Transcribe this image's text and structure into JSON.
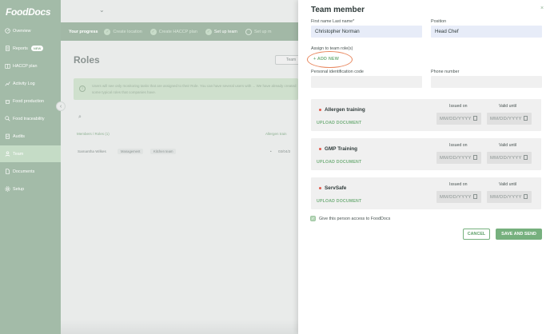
{
  "app": {
    "logo": "FoodDocs"
  },
  "sidebar": {
    "items": [
      {
        "label": "Overview",
        "icon": "gauge-icon"
      },
      {
        "label": "Reports",
        "icon": "report-icon",
        "badge": "NEW"
      },
      {
        "label": "HACCP plan",
        "icon": "book-icon"
      },
      {
        "label": "Activity Log",
        "icon": "chart-icon"
      },
      {
        "label": "Food production",
        "icon": "pot-icon"
      },
      {
        "label": "Food traceability",
        "icon": "search-icon"
      },
      {
        "label": "Audits",
        "icon": "clipboard-icon"
      },
      {
        "label": "Team",
        "icon": "user-icon",
        "active": true
      },
      {
        "label": "Documents",
        "icon": "document-icon"
      },
      {
        "label": "Setup",
        "icon": "gear-icon"
      }
    ]
  },
  "progress": {
    "label": "Your progress",
    "steps": [
      {
        "label": "Create location",
        "done": true
      },
      {
        "label": "Create HACCP plan",
        "done": true
      },
      {
        "label": "Set up team",
        "done": true,
        "current": true
      },
      {
        "label": "Set up m",
        "done": false
      }
    ]
  },
  "roles": {
    "title": "Roles",
    "team_button": "Team",
    "info": "Users will see only monitoring tasks that are assigned to their Role. You can have several users with ... We have already created some typical roles that companies have.",
    "columns": [
      "Members / Roles (1)",
      "Allergen train"
    ],
    "row": {
      "member": "Samantha Wilkes",
      "tags": [
        "Management",
        "Kitchen team"
      ],
      "date": "03/04/2"
    }
  },
  "panel": {
    "title": "Team member",
    "close": "×",
    "fields": {
      "name_label": "First name Last name*",
      "name_value": "Christopher Norman",
      "position_label": "Position",
      "position_value": "Head Chef",
      "assign_label": "Assign to team role(s)",
      "add_new": "+ ADD NEW",
      "pid_label": "Personal identification code",
      "pid_value": "",
      "phone_label": "Phone number",
      "phone_value": ""
    },
    "certificates": [
      {
        "name": "Allergen training",
        "upload": "UPLOAD DOCUMENT",
        "issued_label": "Issued on",
        "valid_label": "Valid until",
        "issued": "MM/DD/YYYY",
        "valid": "MM/DD/YYYY"
      },
      {
        "name": "GMP Training",
        "upload": "UPLOAD DOCUMENT",
        "issued_label": "Issued on",
        "valid_label": "Valid until",
        "issued": "MM/DD/YYYY",
        "valid": "MM/DD/YYYY"
      },
      {
        "name": "ServSafe",
        "upload": "UPLOAD DOCUMENT",
        "issued_label": "Issued on",
        "valid_label": "Valid until",
        "issued": "MM/DD/YYYY",
        "valid": "MM/DD/YYYY"
      }
    ],
    "access_label": "Give this person access to FoodDocs",
    "cancel": "CANCEL",
    "save": "SAVE AND SEND"
  },
  "colors": {
    "accent": "#76b07e",
    "sidebar": "#a3bba8",
    "highlight": "#e8875e",
    "required_dot": "#e25a4b"
  }
}
